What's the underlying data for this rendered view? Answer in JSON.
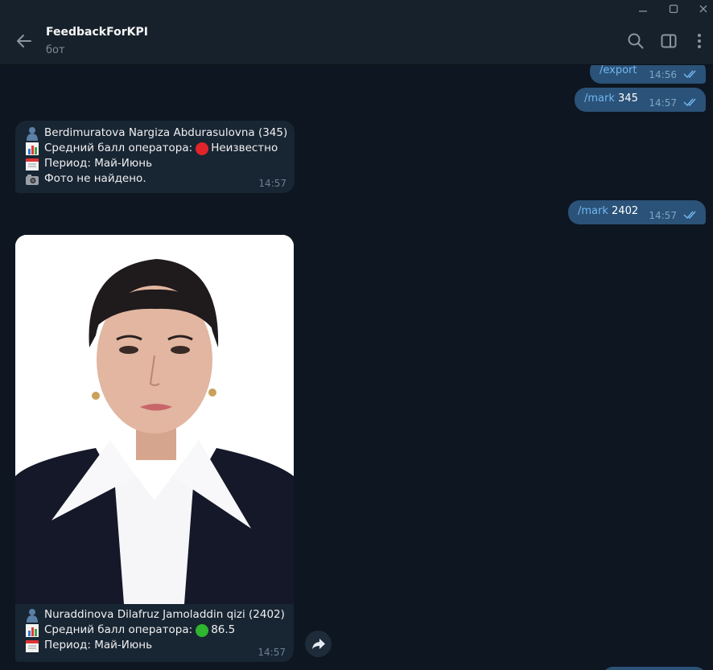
{
  "window": {
    "minimize": "—",
    "maximize": "☐",
    "close": "✕"
  },
  "header": {
    "title": "FeedbackForKPI",
    "subtitle": "бот"
  },
  "messages_out": [
    {
      "command": "/export",
      "text": "",
      "time": "14:56"
    },
    {
      "command": "/mark",
      "text": " 345",
      "time": "14:57"
    },
    {
      "command": "/mark",
      "text": " 2402",
      "time": "14:57"
    }
  ],
  "message_in_1": {
    "name": "Berdimuratova Nargiza Abdurasulovna (345)",
    "score_label": "Средний балл оператора:",
    "score_value": "Неизвестно",
    "period": "Период: Май-Июнь",
    "photo_status": "Фото не найдено.",
    "time": "14:57"
  },
  "message_in_2": {
    "name": "Nuraddinova Dilafruz Jamoladdin qizi (2402)",
    "score_label": "Средний балл оператора:",
    "score_value": "86.5",
    "period": "Период: Май-Июнь",
    "time": "14:57"
  },
  "colors": {
    "accent": "#71b7f2",
    "out_bubble": "#2b5278",
    "in_bubble": "#182533",
    "background": "#0e1621"
  }
}
